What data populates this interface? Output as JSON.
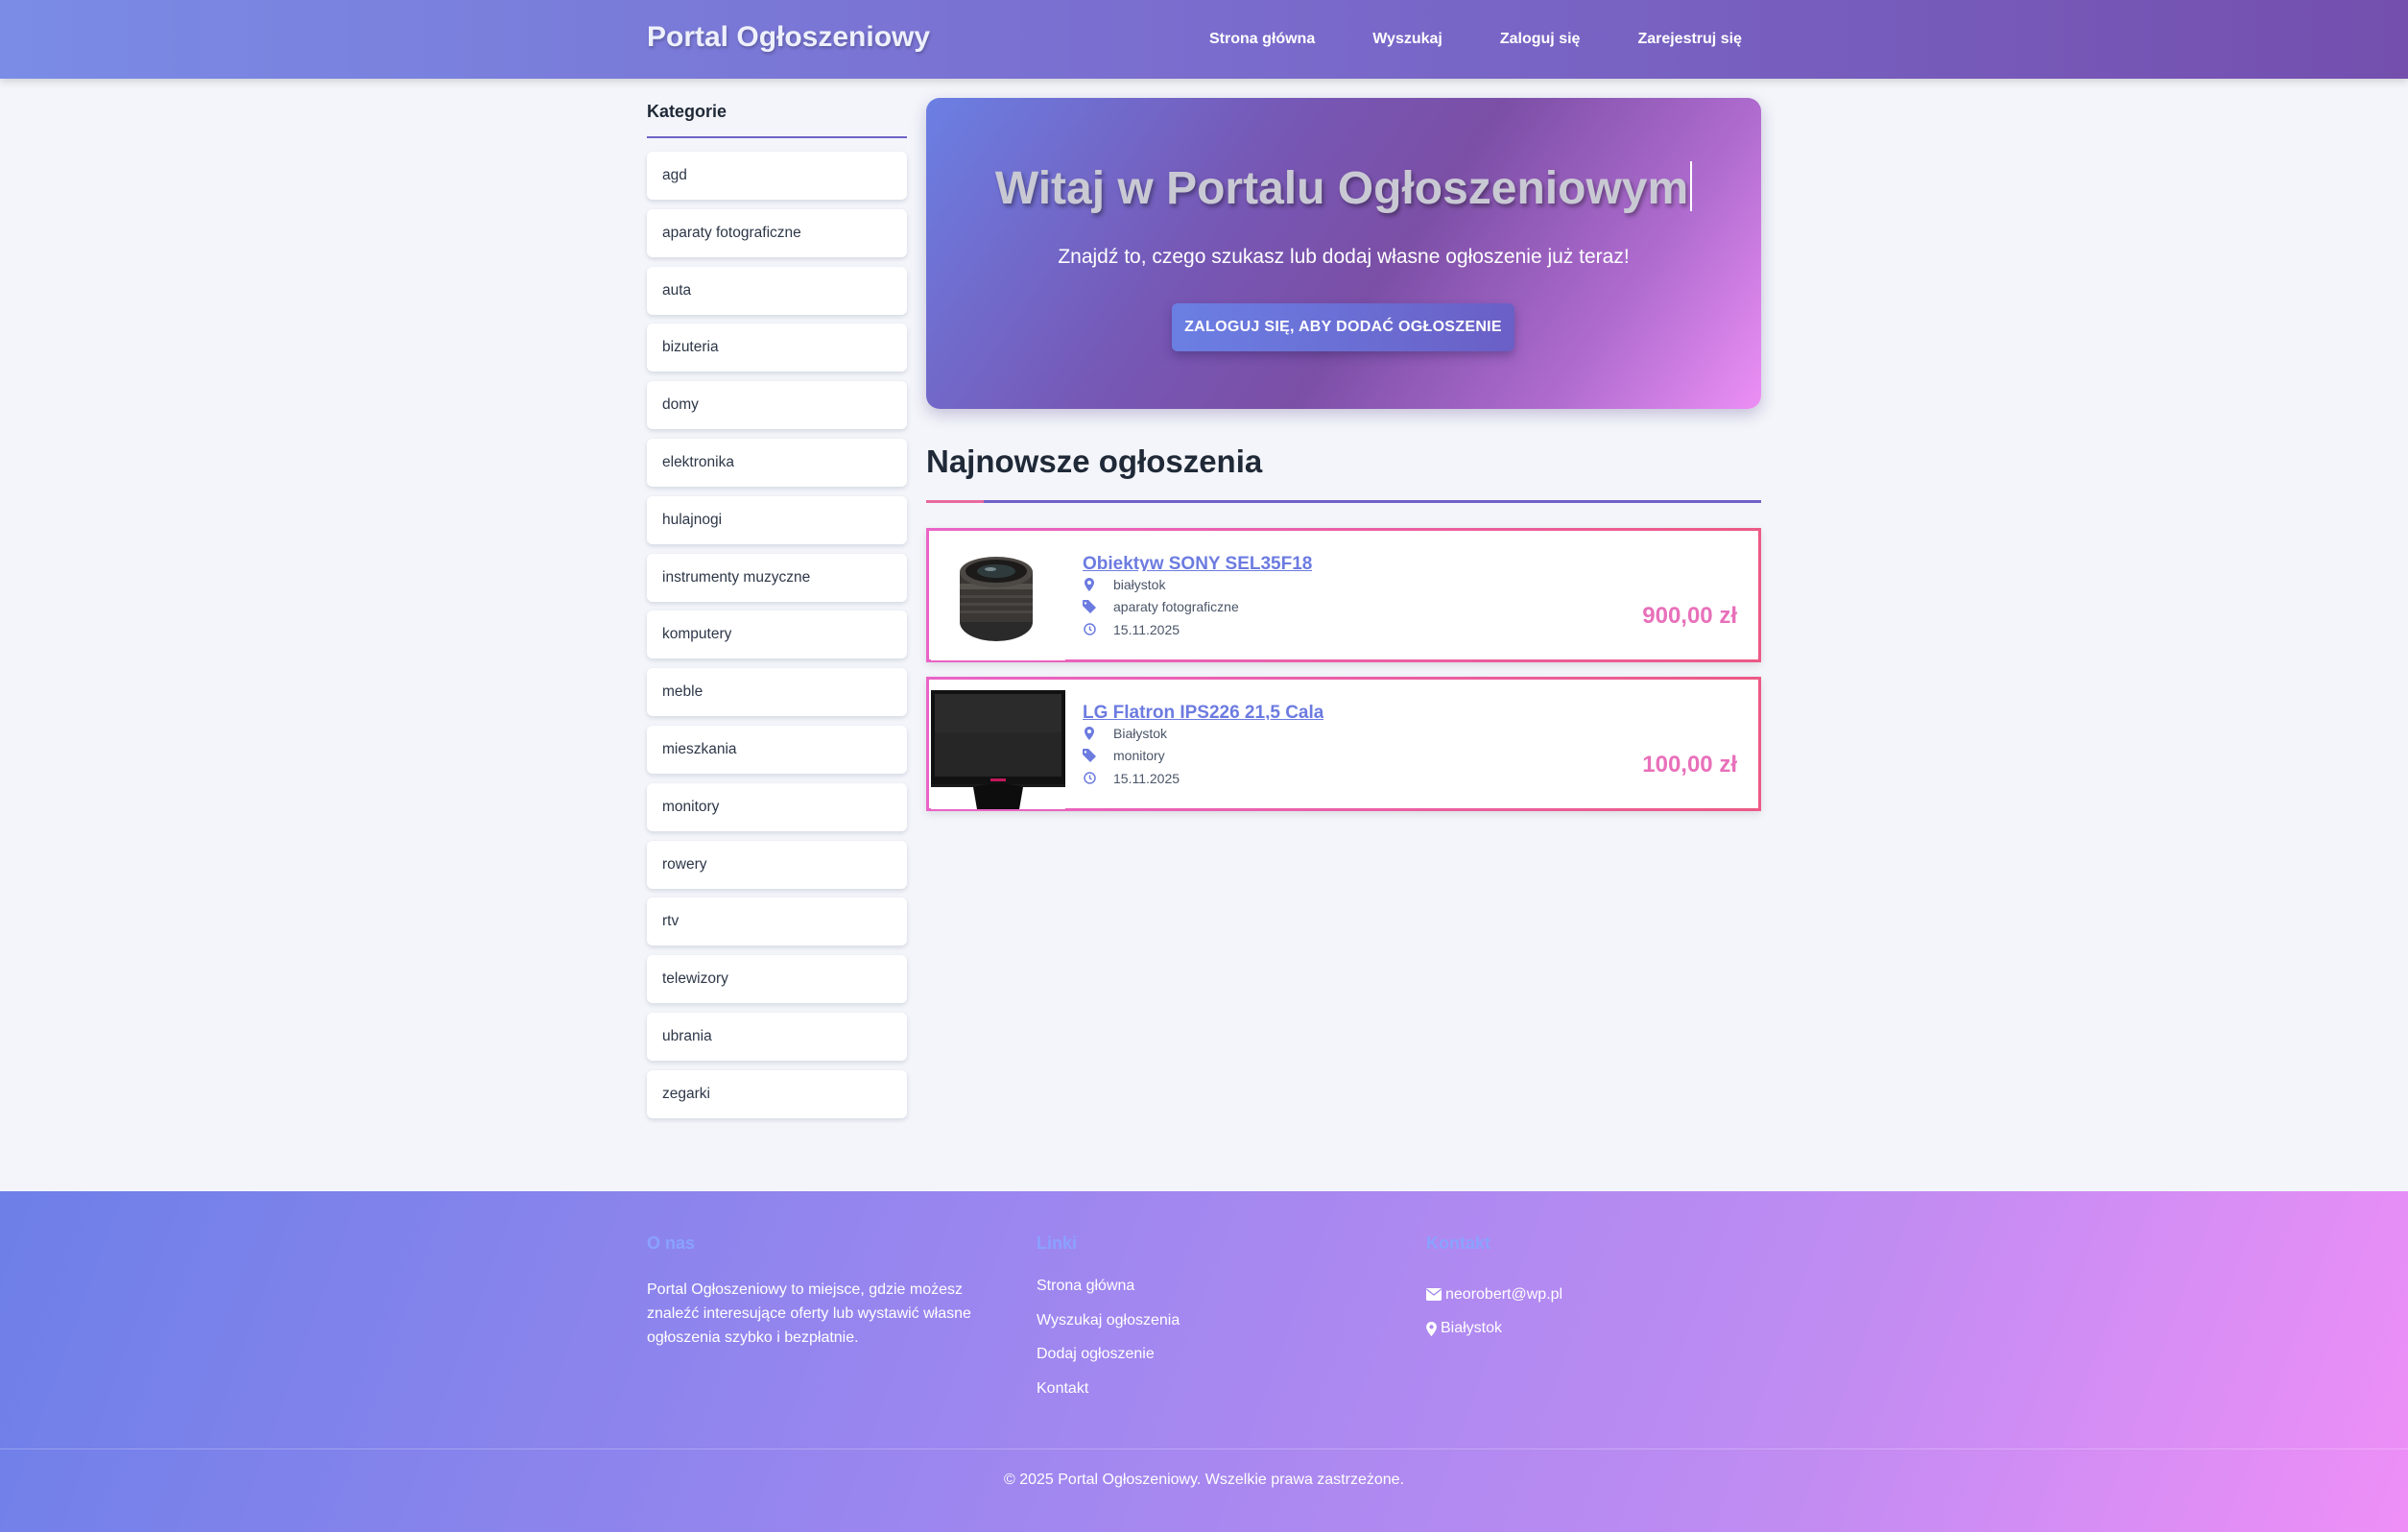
{
  "header": {
    "brand": "Portal Ogłoszeniowy",
    "nav": [
      {
        "label": "Strona główna"
      },
      {
        "label": "Wyszukaj"
      },
      {
        "label": "Zaloguj się"
      },
      {
        "label": "Zarejestruj się"
      }
    ]
  },
  "sidebar": {
    "title": "Kategorie",
    "categories": [
      "agd",
      "aparaty fotograficzne",
      "auta",
      "bizuteria",
      "domy",
      "elektronika",
      "hulajnogi",
      "instrumenty muzyczne",
      "komputery",
      "meble",
      "mieszkania",
      "monitory",
      "rowery",
      "rtv",
      "telewizory",
      "ubrania",
      "zegarki"
    ]
  },
  "hero": {
    "title": "Witaj w Portalu Ogłoszeniowym",
    "subtitle": "Znajdź to, czego szukasz lub dodaj własne ogłoszenie już teraz!",
    "button": "ZALOGUJ SIĘ, ABY DODAĆ OGŁOSZENIE"
  },
  "latest": {
    "title": "Najnowsze ogłoszenia",
    "ads": [
      {
        "title": "Obiektyw SONY SEL35F18",
        "location": "białystok",
        "category": "aparaty fotograficzne",
        "date": "15.11.2025",
        "price": "900,00 zł",
        "image_icon": "camera-lens-photo"
      },
      {
        "title": "LG Flatron IPS226 21,5 Cala",
        "location": "Białystok",
        "category": "monitory",
        "date": "15.11.2025",
        "price": "100,00 zł",
        "image_icon": "monitor-photo"
      }
    ]
  },
  "footer": {
    "about": {
      "heading": "O nas",
      "text": "Portal Ogłoszeniowy to miejsce, gdzie możesz znaleźć interesujące oferty lub wystawić własne ogłoszenia szybko i bezpłatnie."
    },
    "links": {
      "heading": "Linki",
      "items": [
        "Strona główna",
        "Wyszukaj ogłoszenia",
        "Dodaj ogłoszenie",
        "Kontakt"
      ]
    },
    "contact": {
      "heading": "Kontakt",
      "email": "neorobert@wp.pl",
      "city": "Białystok"
    },
    "copyright": "© 2025 Portal Ogłoszeniowy. Wszelkie prawa zastrzeżone."
  },
  "colors": {
    "accent": "#6c7be0",
    "price": "#e870ba",
    "header_start": "#7a8ce6",
    "header_end": "#744fae"
  }
}
